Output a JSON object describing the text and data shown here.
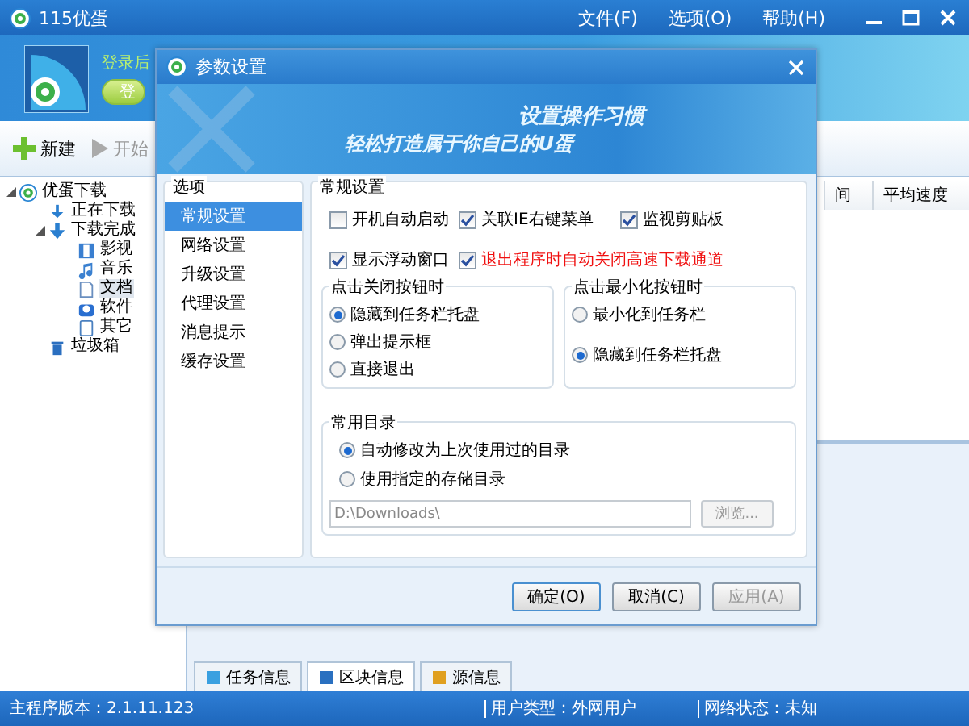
{
  "window": {
    "title": "115优蛋",
    "menu": [
      "文件(F)",
      "选项(O)",
      "帮助(H)"
    ]
  },
  "header": {
    "login_hint": "登录后",
    "login_button": "登"
  },
  "toolbar": [
    {
      "label": "新建",
      "disabled": false
    },
    {
      "label": "开始",
      "disabled": true
    }
  ],
  "tree": [
    {
      "label": "优蛋下载",
      "expanded": true,
      "selected": false,
      "children": [
        {
          "label": "正在下载",
          "selected": false
        },
        {
          "label": "下载完成",
          "expanded": true,
          "selected": false,
          "children": [
            {
              "label": "影视",
              "selected": false
            },
            {
              "label": "音乐",
              "selected": false
            },
            {
              "label": "文档",
              "selected": true
            },
            {
              "label": "软件",
              "selected": false
            },
            {
              "label": "其它",
              "selected": false
            }
          ]
        },
        {
          "label": "垃圾箱",
          "selected": false
        }
      ]
    }
  ],
  "table": {
    "columns": [
      "间",
      "平均速度"
    ]
  },
  "bottom_tabs": [
    {
      "label": "任务信息",
      "selected": false
    },
    {
      "label": "区块信息",
      "selected": true
    },
    {
      "label": "源信息",
      "selected": false
    }
  ],
  "status_bar": [
    "主程序版本：2.1.11.123",
    "用户类型：外网用户",
    "网络状态：未知"
  ],
  "dialog": {
    "title": "参数设置",
    "banner": [
      "设置操作习惯",
      "轻松打造属于你自己的U蛋"
    ],
    "options_title": "选项",
    "options": [
      {
        "label": "常规设置",
        "selected": true
      },
      {
        "label": "网络设置",
        "selected": false
      },
      {
        "label": "升级设置",
        "selected": false
      },
      {
        "label": "代理设置",
        "selected": false
      },
      {
        "label": "消息提示",
        "selected": false
      },
      {
        "label": "缓存设置",
        "selected": false
      }
    ],
    "general": {
      "title": "常规设置",
      "checkboxes": [
        {
          "label": "开机自动启动",
          "checked": false,
          "warning": false
        },
        {
          "label": "关联IE右键菜单",
          "checked": true,
          "warning": false
        },
        {
          "label": "监视剪贴板",
          "checked": true,
          "warning": false
        },
        {
          "label": "显示浮动窗口",
          "checked": true,
          "warning": false
        },
        {
          "label": "退出程序时自动关闭高速下载通道",
          "checked": true,
          "warning": true
        }
      ],
      "close_group": {
        "title": "点击关闭按钮时",
        "options": [
          {
            "label": "隐藏到任务栏托盘",
            "selected": true
          },
          {
            "label": "弹出提示框",
            "selected": false
          },
          {
            "label": "直接退出",
            "selected": false
          }
        ]
      },
      "minimize_group": {
        "title": "点击最小化按钮时",
        "options": [
          {
            "label": "最小化到任务栏",
            "selected": false
          },
          {
            "label": "隐藏到任务栏托盘",
            "selected": true
          }
        ]
      },
      "directory_group": {
        "title": "常用目录",
        "options": [
          {
            "label": "自动修改为上次使用过的目录",
            "selected": true
          },
          {
            "label": "使用指定的存储目录",
            "selected": false
          }
        ],
        "path": "D:\\Downloads\\",
        "browse": "浏览...",
        "browse_disabled": true
      }
    },
    "buttons": [
      {
        "label": "确定(O)",
        "disabled": false,
        "default": true
      },
      {
        "label": "取消(C)",
        "disabled": false,
        "default": false
      },
      {
        "label": "应用(A)",
        "disabled": true,
        "default": false
      }
    ]
  }
}
